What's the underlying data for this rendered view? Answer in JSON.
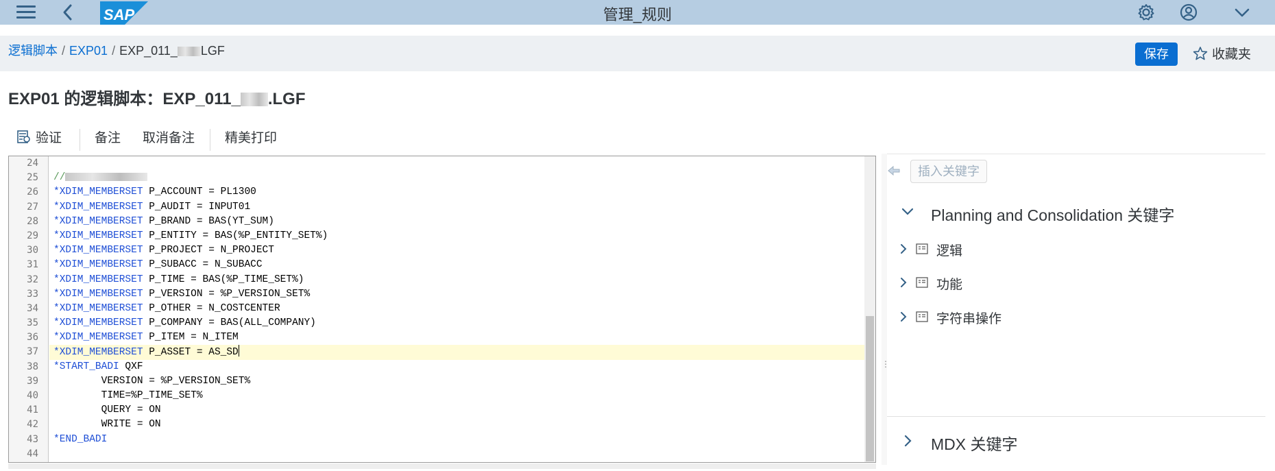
{
  "shell": {
    "title": "管理_规则",
    "logo_text": "SAP",
    "icons": [
      "menu-icon",
      "back-icon",
      "settings-icon",
      "user-icon",
      "chevron-down-icon"
    ]
  },
  "breadcrumb": {
    "items": [
      "逻辑脚本",
      "EXP01"
    ],
    "current_prefix": "EXP_011_",
    "current_suffix": "LGF"
  },
  "header_actions": {
    "save_label": "保存",
    "favorites_label": "收藏夹"
  },
  "page": {
    "title_prefix": "EXP01 的逻辑脚本：EXP_011_",
    "title_suffix": ".LGF"
  },
  "toolbar": {
    "validate_label": "验证",
    "comment_label": "备注",
    "uncomment_label": "取消备注",
    "prettyprint_label": "精美打印"
  },
  "editor": {
    "line_numbers": [
      "24",
      "25",
      "26",
      "27",
      "28",
      "29",
      "30",
      "31",
      "32",
      "33",
      "34",
      "35",
      "36",
      "37",
      "38",
      "39",
      "40",
      "41",
      "42",
      "43",
      "44"
    ],
    "lines": [
      {
        "kw": "",
        "text": ""
      },
      {
        "kw": "",
        "text": "//",
        "comment": true
      },
      {
        "kw": "*XDIM_MEMBERSET",
        "text": " P_ACCOUNT = PL1300"
      },
      {
        "kw": "*XDIM_MEMBERSET",
        "text": " P_AUDIT = INPUT01"
      },
      {
        "kw": "*XDIM_MEMBERSET",
        "text": " P_BRAND = BAS(YT_SUM)"
      },
      {
        "kw": "*XDIM_MEMBERSET",
        "text": " P_ENTITY = BAS(%P_ENTITY_SET%)"
      },
      {
        "kw": "*XDIM_MEMBERSET",
        "text": " P_PROJECT = N_PROJECT"
      },
      {
        "kw": "*XDIM_MEMBERSET",
        "text": " P_SUBACC = N_SUBACC"
      },
      {
        "kw": "*XDIM_MEMBERSET",
        "text": " P_TIME = BAS(%P_TIME_SET%)"
      },
      {
        "kw": "*XDIM_MEMBERSET",
        "text": " P_VERSION = %P_VERSION_SET%"
      },
      {
        "kw": "*XDIM_MEMBERSET",
        "text": " P_OTHER = N_COSTCENTER"
      },
      {
        "kw": "*XDIM_MEMBERSET",
        "text": " P_COMPANY = BAS(ALL_COMPANY)"
      },
      {
        "kw": "*XDIM_MEMBERSET",
        "text": " P_ITEM = N_ITEM"
      },
      {
        "kw": "*XDIM_MEMBERSET",
        "text": " P_ASSET = AS_SD",
        "active": true
      },
      {
        "kw": "*START_BADI",
        "text": " QXF"
      },
      {
        "kw": "",
        "text": "        VERSION = %P_VERSION_SET%"
      },
      {
        "kw": "",
        "text": "        TIME=%P_TIME_SET%"
      },
      {
        "kw": "",
        "text": "        QUERY = ON"
      },
      {
        "kw": "",
        "text": "        WRITE = ON"
      },
      {
        "kw": "*END_BADI",
        "text": ""
      },
      {
        "kw": "",
        "text": ""
      }
    ]
  },
  "keywords_panel": {
    "insert_label": "插入关键字",
    "section1_title": "Planning and Consolidation 关键字",
    "nodes": [
      "逻辑",
      "功能",
      "字符串操作"
    ],
    "section2_title": "MDX 关键字"
  }
}
